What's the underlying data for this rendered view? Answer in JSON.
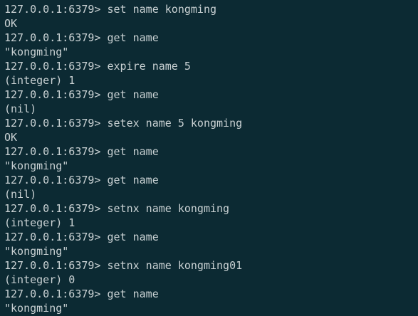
{
  "terminal": {
    "lines": [
      {
        "type": "input",
        "prompt": "127.0.0.1:6379> ",
        "command": "set name kongming"
      },
      {
        "type": "output",
        "text": "OK"
      },
      {
        "type": "input",
        "prompt": "127.0.0.1:6379> ",
        "command": "get name"
      },
      {
        "type": "output",
        "text": "\"kongming\""
      },
      {
        "type": "input",
        "prompt": "127.0.0.1:6379> ",
        "command": "expire name 5"
      },
      {
        "type": "output",
        "text": "(integer) 1"
      },
      {
        "type": "input",
        "prompt": "127.0.0.1:6379> ",
        "command": "get name"
      },
      {
        "type": "output",
        "text": "(nil)"
      },
      {
        "type": "input",
        "prompt": "127.0.0.1:6379> ",
        "command": "setex name 5 kongming"
      },
      {
        "type": "output",
        "text": "OK"
      },
      {
        "type": "input",
        "prompt": "127.0.0.1:6379> ",
        "command": "get name"
      },
      {
        "type": "output",
        "text": "\"kongming\""
      },
      {
        "type": "input",
        "prompt": "127.0.0.1:6379> ",
        "command": "get name"
      },
      {
        "type": "output",
        "text": "(nil)"
      },
      {
        "type": "input",
        "prompt": "127.0.0.1:6379> ",
        "command": "setnx name kongming"
      },
      {
        "type": "output",
        "text": "(integer) 1"
      },
      {
        "type": "input",
        "prompt": "127.0.0.1:6379> ",
        "command": "get name"
      },
      {
        "type": "output",
        "text": "\"kongming\""
      },
      {
        "type": "input",
        "prompt": "127.0.0.1:6379> ",
        "command": "setnx name kongming01"
      },
      {
        "type": "output",
        "text": "(integer) 0"
      },
      {
        "type": "input",
        "prompt": "127.0.0.1:6379> ",
        "command": "get name"
      },
      {
        "type": "output",
        "text": "\"kongming\""
      }
    ]
  }
}
